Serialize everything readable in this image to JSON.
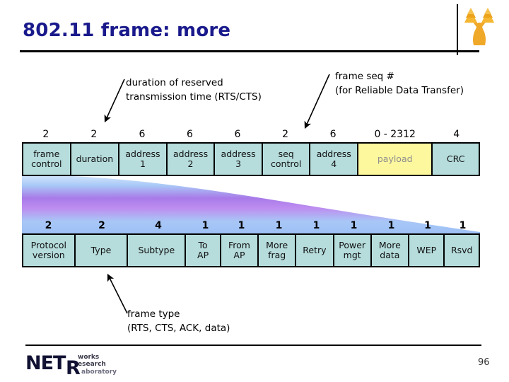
{
  "slide": {
    "title": "802.11 frame: more",
    "page_number": "96",
    "accent_color": "#1a1a8c",
    "cell_color": "#b6dcdc",
    "payload_color": "#fdf79e"
  },
  "logo": {
    "tree_icon": "tree-icon",
    "tree_color": "#f0a020",
    "brand_net": "NET",
    "brand_r": "R",
    "brand_works": "works",
    "brand_research": "esearch",
    "brand_laboratory": "aboratory"
  },
  "callouts": [
    {
      "id": "duration",
      "lines": [
        "duration of reserved",
        "transmission time (RTS/CTS)"
      ]
    },
    {
      "id": "seq",
      "lines": [
        "frame seq #",
        "(for Reliable Data Transfer)"
      ]
    },
    {
      "id": "frametype",
      "lines": [
        "frame type",
        "(RTS, CTS, ACK, data)"
      ]
    }
  ],
  "frame_main": {
    "sizes": [
      "2",
      "2",
      "6",
      "6",
      "6",
      "2",
      "6",
      "0 - 2312",
      "4"
    ],
    "fields": [
      {
        "lines": [
          "frame",
          "control"
        ],
        "type": "normal",
        "flex": 64
      },
      {
        "lines": [
          "duration"
        ],
        "type": "normal",
        "flex": 65
      },
      {
        "lines": [
          "address",
          "1"
        ],
        "type": "normal",
        "flex": 64
      },
      {
        "lines": [
          "address",
          "2"
        ],
        "type": "normal",
        "flex": 64
      },
      {
        "lines": [
          "address",
          "3"
        ],
        "type": "normal",
        "flex": 64
      },
      {
        "lines": [
          "seq",
          "control"
        ],
        "type": "normal",
        "flex": 64
      },
      {
        "lines": [
          "address",
          "4"
        ],
        "type": "normal",
        "flex": 64
      },
      {
        "lines": [
          "payload"
        ],
        "type": "payload",
        "flex": 102
      },
      {
        "lines": [
          "CRC"
        ],
        "type": "normal",
        "flex": 63
      }
    ]
  },
  "frame_control": {
    "sizes": [
      "2",
      "2",
      "4",
      "1",
      "1",
      "1",
      "1",
      "1",
      "1",
      "1",
      "1"
    ],
    "fields": [
      {
        "lines": [
          "Protocol",
          "version"
        ],
        "flex": 75
      },
      {
        "lines": [
          "Type"
        ],
        "flex": 76
      },
      {
        "lines": [
          "Subtype"
        ],
        "flex": 84
      },
      {
        "lines": [
          "To",
          "AP"
        ],
        "flex": 49
      },
      {
        "lines": [
          "From",
          "AP"
        ],
        "flex": 53
      },
      {
        "lines": [
          "More",
          "frag"
        ],
        "flex": 53
      },
      {
        "lines": [
          "Retry"
        ],
        "flex": 53
      },
      {
        "lines": [
          "Power",
          "mgt"
        ],
        "flex": 53
      },
      {
        "lines": [
          "More",
          "data"
        ],
        "flex": 53
      },
      {
        "lines": [
          "WEP"
        ],
        "flex": 50
      },
      {
        "lines": [
          "Rsvd"
        ],
        "flex": 49
      }
    ]
  }
}
